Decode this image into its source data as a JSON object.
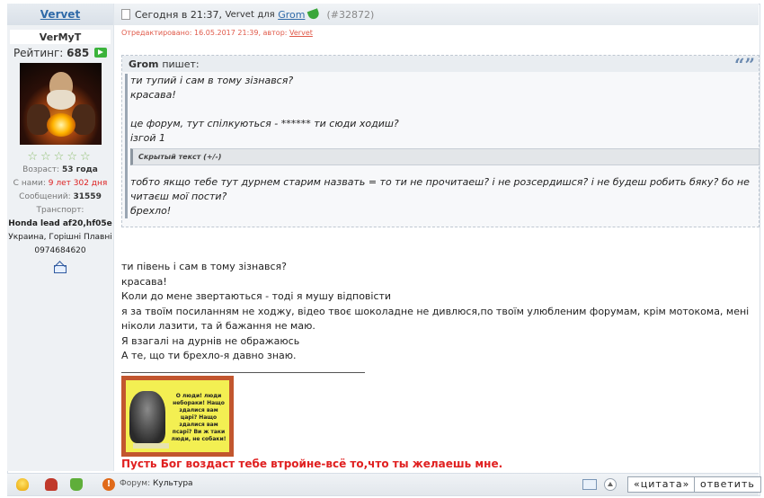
{
  "user": {
    "link_name": "Vervet",
    "nickname": "VerMyT",
    "rating_label": "Рейтинг:",
    "rating_value": "685",
    "stars": "☆☆☆☆☆",
    "age_label": "Возраст:",
    "age_value": "53 года",
    "since_label": "С нами:",
    "since_value": "9 лет 302 дня",
    "posts_label": "Сообщений:",
    "posts_value": "31559",
    "transport_label": "Транспорт:",
    "transport_value": "Honda lead af20,hf05e",
    "location": "Украина, Горішні Плавні",
    "phone": "0974684620"
  },
  "post": {
    "header_prefix": "Сегодня в 21:37,",
    "author": "Vervet",
    "for_label": "для",
    "recipient": "Grom",
    "post_id": "(#32872)",
    "edited_text": "Отредактировано: 16.05.2017 21:39, автор:",
    "edited_author": "Vervet"
  },
  "quote": {
    "author": "Grom",
    "author_suffix": "пишет:",
    "marks": "“”",
    "lines_a": [
      "ти  тупий і сам в тому зізнався?",
      "красава!",
      "",
      "це форум, тут спілкуються -  ******  ти сюди ходиш?",
      "ізгой 1"
    ],
    "spoiler": "Скрытый текст (+/-)",
    "lines_b": [
      "",
      "тобто якщо тебе тут дурнем старим назвать = то ти не прочитаеш? і не розсердишся? і не будеш робить бяку? бо не читаєш мої пости?",
      "брехло!"
    ]
  },
  "body_lines": [
    "ти  півень і сам в тому зізнався?",
    "красава!",
    "Коли до мене  звертаються - тоді я мушу  відповісти",
    "я за твоїм посиланням не ходжу, відео твоє шоколадне не дивлюся,по твоїм улюбленим форумам, крім мотокома, мені ніколи лазити, та й бажання не маю.",
    "Я взагалі на дурнів не ображаюсь",
    "А те, що ти брехло-я давно знаю."
  ],
  "picture_text": "О люди! люди небораки! Нащо здалися вам царі? Нащо здалися вам псарі? Ви ж таки люди, не собаки!",
  "signature": "Пусть Бог воздаст тебе втройне-всё то,что ты желаешь мне.",
  "footer": {
    "forum_label": "Форум:",
    "forum_name": "Культура",
    "quote_button": "«цитата»",
    "reply_button": "ответить",
    "warn_glyph": "!"
  },
  "icons": [
    "lightbulb-icon",
    "thumbs-down-icon",
    "thumbs-up-icon",
    "warning-icon",
    "envelope-icon",
    "arrow-up-icon",
    "document-icon",
    "phone-icon"
  ],
  "colors": {
    "link": "#2f6aa8",
    "edited": "#e05a4a",
    "signature": "#e02020",
    "plus": "#3bb33b"
  }
}
